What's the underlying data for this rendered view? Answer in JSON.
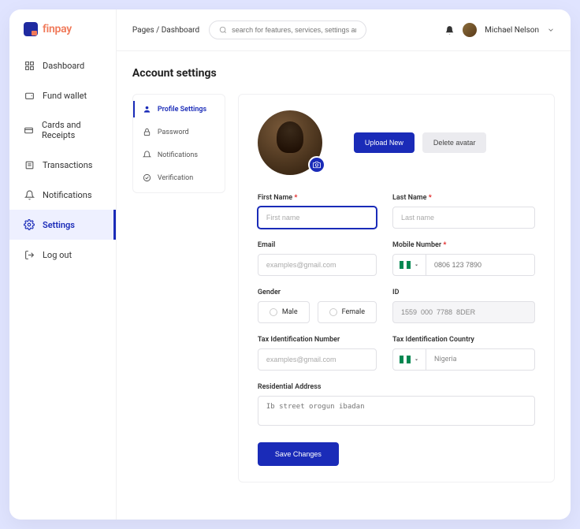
{
  "brand": {
    "name": "finpay"
  },
  "topbar": {
    "breadcrumb": "Pages / Dashboard",
    "search_placeholder": "search for features, services, settings and more",
    "user_name": "Michael Nelson"
  },
  "sidebar": {
    "items": [
      {
        "label": "Dashboard"
      },
      {
        "label": "Fund wallet"
      },
      {
        "label": "Cards and Receipts"
      },
      {
        "label": "Transactions"
      },
      {
        "label": "Notifications"
      },
      {
        "label": "Settings"
      },
      {
        "label": "Log out"
      }
    ]
  },
  "page": {
    "title": "Account settings"
  },
  "settings_nav": {
    "items": [
      {
        "label": "Profile Settings"
      },
      {
        "label": "Password"
      },
      {
        "label": "Notifications"
      },
      {
        "label": "Verification"
      }
    ]
  },
  "avatar_actions": {
    "upload": "Upload New",
    "delete": "Delete avatar"
  },
  "form": {
    "first_name": {
      "label": "First Name",
      "placeholder": "First name"
    },
    "last_name": {
      "label": "Last Name",
      "placeholder": "Last name"
    },
    "email": {
      "label": "Email",
      "placeholder": "examples@gmail.com"
    },
    "mobile": {
      "label": "Mobile Number",
      "placeholder": "0806 123 7890"
    },
    "gender": {
      "label": "Gender",
      "options": [
        "Male",
        "Female"
      ]
    },
    "id": {
      "label": "ID",
      "value": "1559  000  7788  8DER"
    },
    "tin": {
      "label": "Tax Identification Number",
      "placeholder": "examples@gmail.com"
    },
    "tax_country": {
      "label": "Tax Identification Country",
      "value": "Nigeria"
    },
    "address": {
      "label": "Residential Address",
      "placeholder": "Ib street orogun ibadan"
    },
    "save": "Save Changes"
  }
}
